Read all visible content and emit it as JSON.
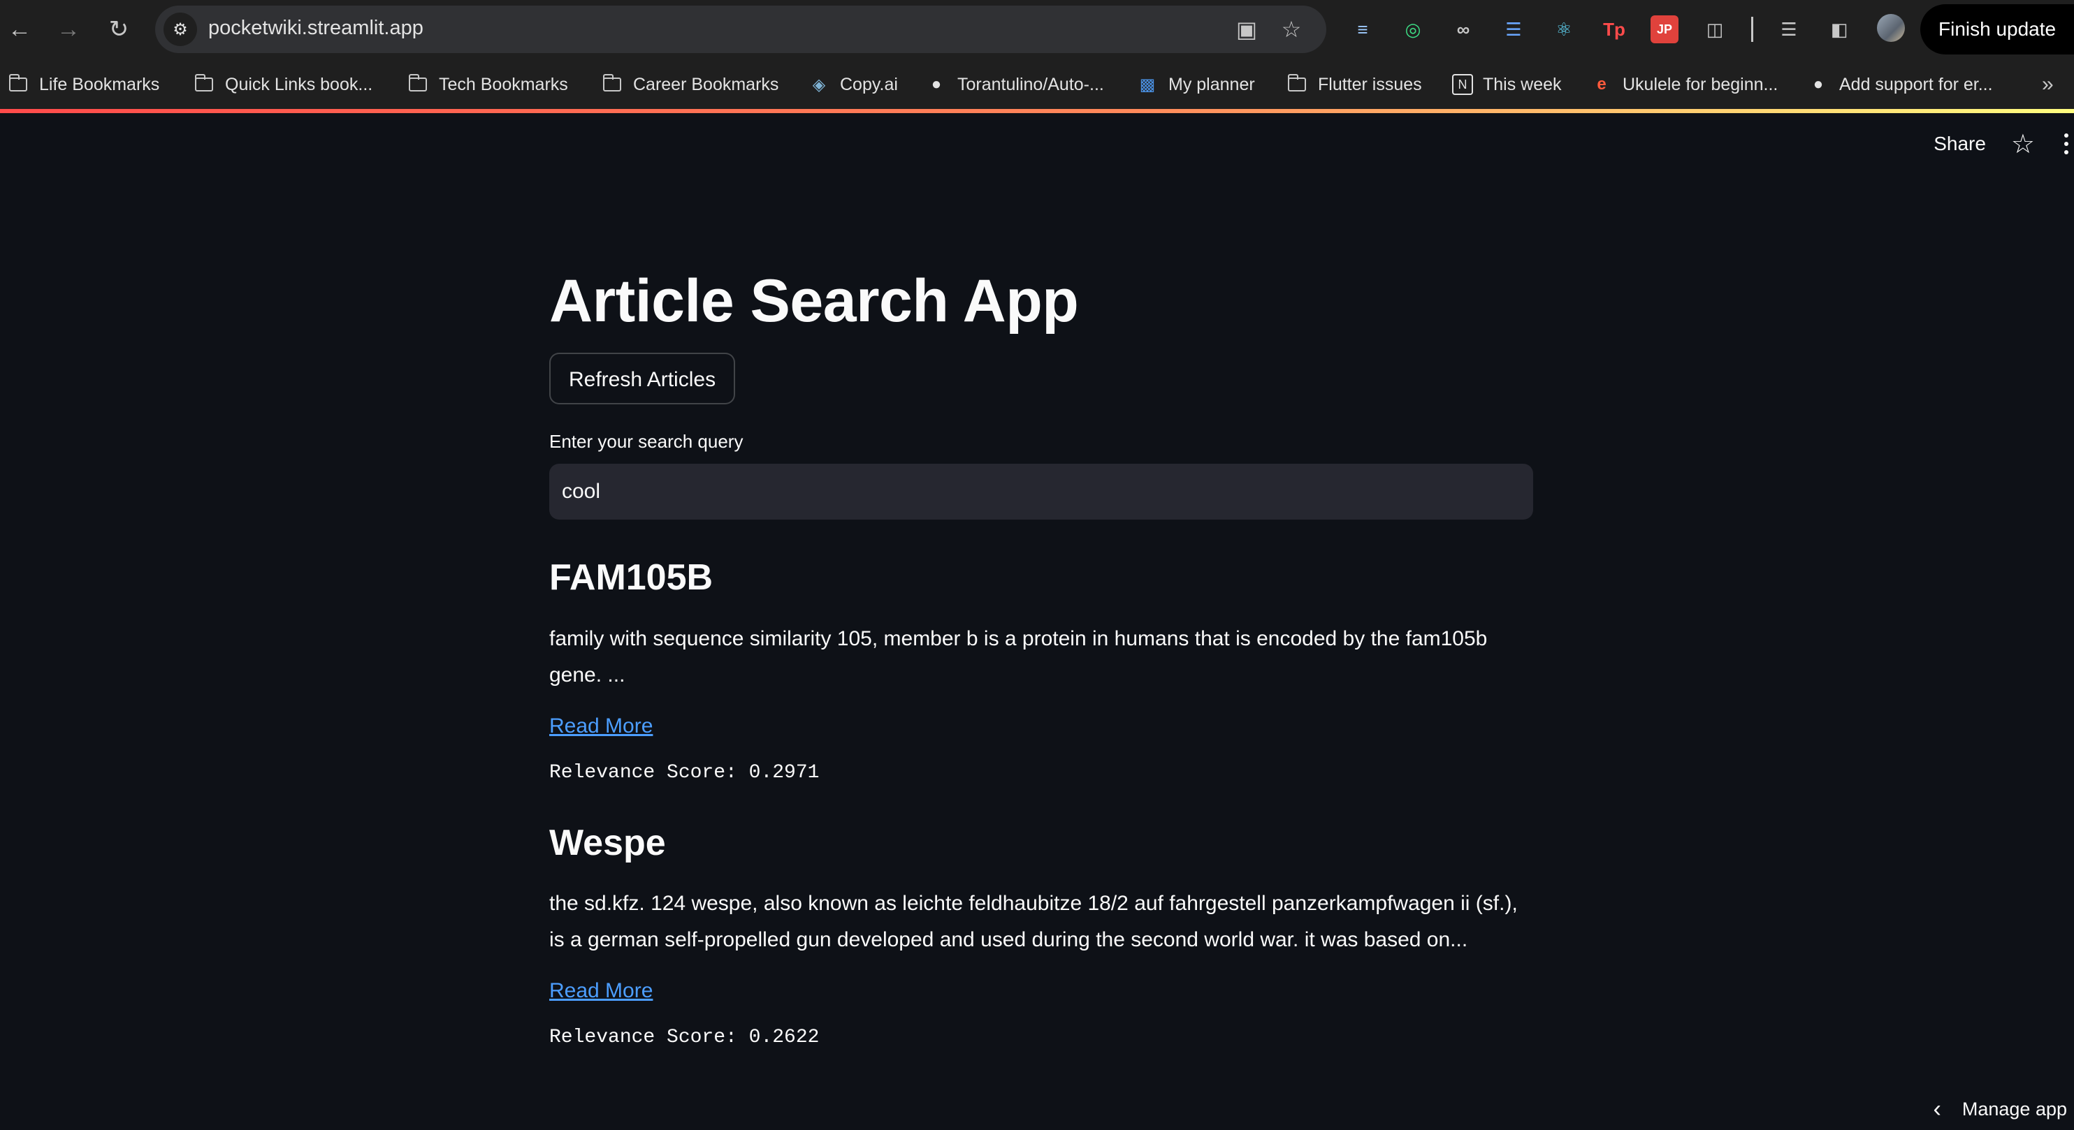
{
  "browser": {
    "url": "pocketwiki.streamlit.app",
    "finish_update_label": "Finish update",
    "bookmarks": [
      {
        "label": "Life Bookmarks",
        "icon": "folder-icon"
      },
      {
        "label": "Quick Links book...",
        "icon": "folder-icon"
      },
      {
        "label": "Tech Bookmarks",
        "icon": "folder-icon"
      },
      {
        "label": "Career Bookmarks",
        "icon": "folder-icon"
      },
      {
        "label": "Copy.ai",
        "icon": "copyai-icon"
      },
      {
        "label": "Torantulino/Auto-...",
        "icon": "github-icon"
      },
      {
        "label": "My planner",
        "icon": "trello-icon"
      },
      {
        "label": "Flutter issues",
        "icon": "folder-icon"
      },
      {
        "label": "This week",
        "icon": "notion-icon"
      },
      {
        "label": "Ukulele for beginn...",
        "icon": "ukulele-site-icon"
      },
      {
        "label": "Add support for er...",
        "icon": "github-icon"
      }
    ]
  },
  "app": {
    "share_label": "Share",
    "title": "Article Search App",
    "refresh_label": "Refresh Articles",
    "search_label": "Enter your search query",
    "search_value": "cool",
    "manage_label": "Manage app",
    "articles": [
      {
        "title": "FAM105B",
        "summary": "family with sequence similarity 105, member b is a protein in humans that is encoded by the fam105b gene. ...",
        "link_label": "Read More",
        "score_text": "Relevance Score: 0.2971"
      },
      {
        "title": "Wespe",
        "summary": "the sd.kfz. 124 wespe, also known as leichte feldhaubitze 18/2 auf fahrgestell panzerkampfwagen ii (sf.), is a german self-propelled gun developed and used during the second world war. it was based on...",
        "link_label": "Read More",
        "score_text": "Relevance Score: 0.2622"
      }
    ]
  }
}
